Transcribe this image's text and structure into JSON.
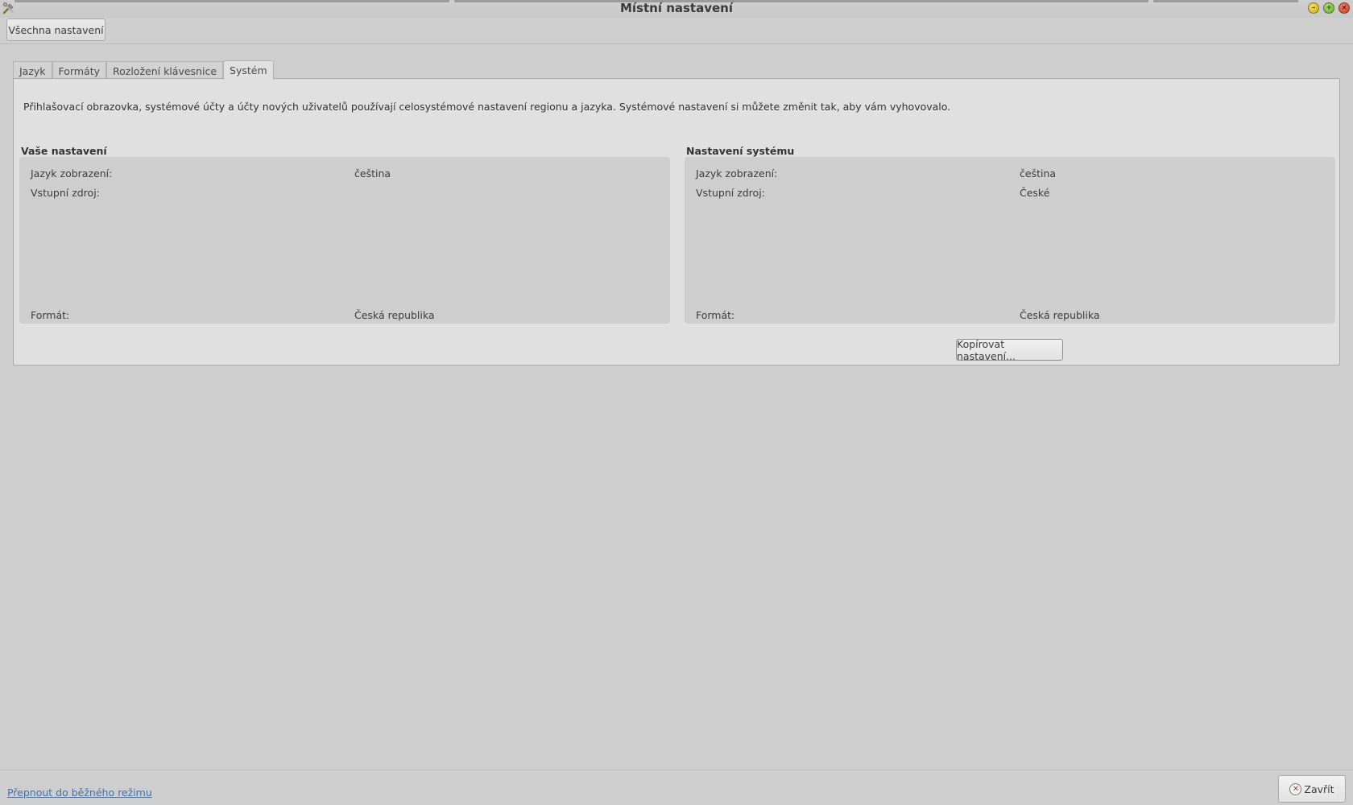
{
  "window": {
    "title": "Místní nastavení",
    "minimize_glyph": "–",
    "maximize_glyph": "+",
    "close_glyph": "×"
  },
  "toolbar": {
    "all_settings_label": "Všechna nastavení"
  },
  "tabs": [
    {
      "label": "Jazyk",
      "active": false
    },
    {
      "label": "Formáty",
      "active": false
    },
    {
      "label": "Rozložení klávesnice",
      "active": false
    },
    {
      "label": "Systém",
      "active": true
    }
  ],
  "system_tab": {
    "intro": "Přihlašovací obrazovka, systémové účty a účty nových uživatelů používají celosystémové nastavení regionu a jazyka. Systémové nastavení si můžete změnit tak, aby vám vyhovovalo.",
    "your_settings": {
      "title": "Vaše nastavení",
      "display_language_label": "Jazyk zobrazení:",
      "display_language_value": "čeština",
      "input_source_label": "Vstupní zdroj:",
      "input_source_value": "",
      "format_label": "Formát:",
      "format_value": "Česká republika"
    },
    "system_settings": {
      "title": "Nastavení systému",
      "display_language_label": "Jazyk zobrazení:",
      "display_language_value": "čeština",
      "input_source_label": "Vstupní zdroj:",
      "input_source_value": "České",
      "format_label": "Formát:",
      "format_value": "Česká republika"
    },
    "copy_button_label": "Kopírovat nastavení..."
  },
  "bottom": {
    "switch_mode_link": "Přepnout do běžného režimu",
    "close_button_label": "Zavřít"
  },
  "colors": {
    "background": "#cecece",
    "panel": "#e0e0e0",
    "link": "#4a6fa0"
  }
}
